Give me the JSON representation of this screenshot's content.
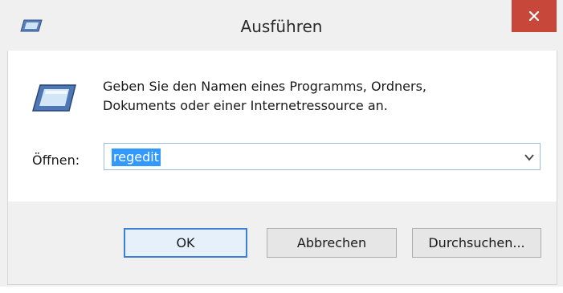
{
  "window": {
    "title": "Ausführen",
    "close_icon": "close-icon"
  },
  "dialog": {
    "description_line1": "Geben Sie den Namen eines Programms, Ordners,",
    "description_line2": "Dokuments oder einer Internetressource an.",
    "open_label": "Öffnen:",
    "open_value": "regedit",
    "run_icon": "run-icon"
  },
  "buttons": {
    "ok": "OK",
    "cancel": "Abbrechen",
    "browse": "Durchsuchen..."
  },
  "colors": {
    "close_red": "#c7473a",
    "selection_blue": "#3399ff",
    "focus_blue": "#3c7fd6"
  }
}
